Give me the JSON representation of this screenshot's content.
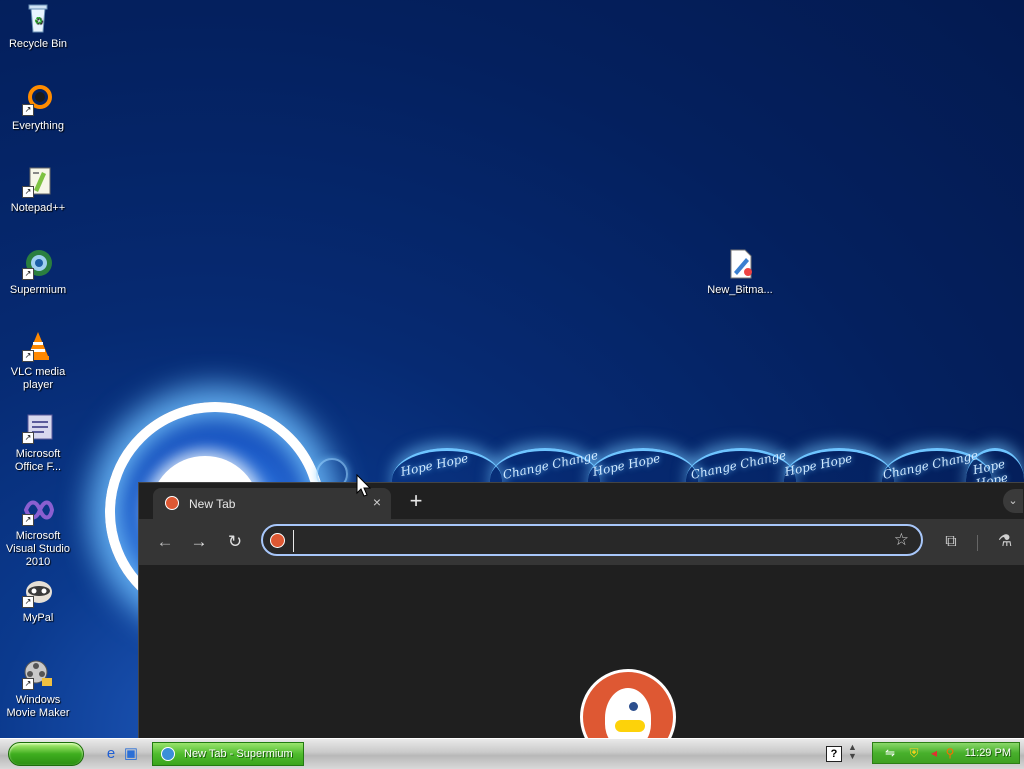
{
  "desktop": {
    "icons": [
      {
        "label": "Recycle Bin",
        "icon": "recycle-bin-icon"
      },
      {
        "label": "Everything",
        "icon": "everything-icon"
      },
      {
        "label": "Notepad++",
        "icon": "notepad-plus-plus-icon"
      },
      {
        "label": "Supermium",
        "icon": "supermium-icon"
      },
      {
        "label": "VLC media player",
        "icon": "vlc-icon"
      },
      {
        "label": "Microsoft Office F...",
        "icon": "office-icon"
      },
      {
        "label": "Microsoft Visual Studio 2010",
        "icon": "visual-studio-icon"
      },
      {
        "label": "MyPal",
        "icon": "mypal-icon"
      },
      {
        "label": "Windows Movie Maker",
        "icon": "movie-maker-icon"
      },
      {
        "label": "New_Bitma...",
        "icon": "bitmap-file-icon"
      }
    ],
    "wallpaper_text": "Hope Hope Change Change Hope Hope Change Change"
  },
  "browser": {
    "tab_title": "New Tab",
    "close_glyph": "×",
    "new_tab_glyph": "+",
    "tab_menu_glyph": "⌄",
    "omnibox": {
      "value": "",
      "placeholder": ""
    },
    "buttons": {
      "back": "←",
      "forward": "→",
      "reload": "↻",
      "bookmark": "☆",
      "extensions": "⧉",
      "labs": "⚗"
    }
  },
  "taskbar": {
    "quick_launch": [
      "internet-explorer-icon",
      "show-desktop-icon"
    ],
    "task_label": "New Tab - Supermium",
    "clock": "11:29 PM"
  },
  "colors": {
    "desktop_blue": "#04205e",
    "taskbar_green": "#4fbc2d",
    "omnibox_focus": "#a8c7fa",
    "ddg_orange": "#de5833"
  }
}
